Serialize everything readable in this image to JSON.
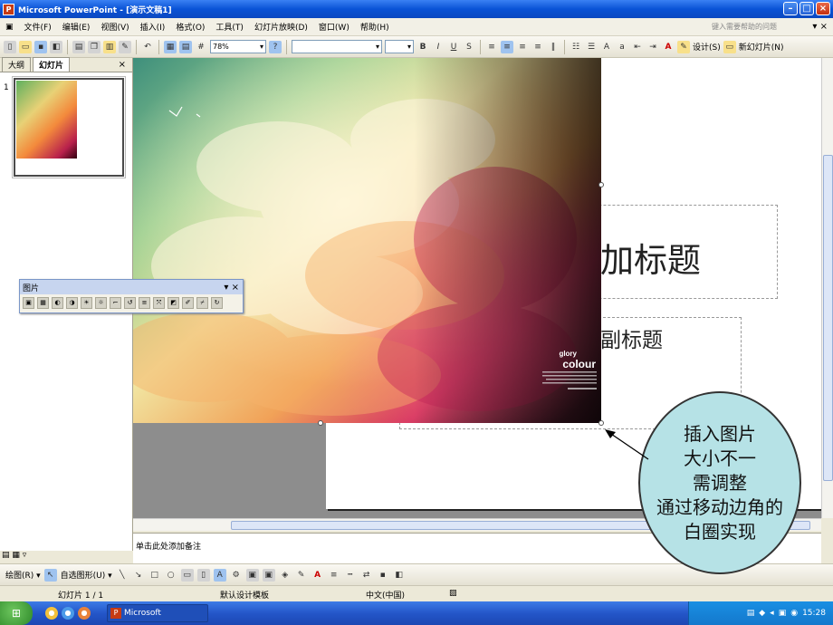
{
  "window": {
    "title": "Microsoft PowerPoint - [演示文稿1]",
    "app_icon": "P"
  },
  "menu": {
    "items": [
      "文件(F)",
      "编辑(E)",
      "视图(V)",
      "插入(I)",
      "格式(O)",
      "工具(T)",
      "幻灯片放映(D)",
      "窗口(W)",
      "帮助(H)"
    ],
    "help_placeholder": "键入需要帮助的问题",
    "close": "▾ ×"
  },
  "toolbar": {
    "zoom": "78%",
    "font_name": "",
    "font_size": "",
    "design_label": "设计(S)",
    "new_slide_label": "新幻灯片(N)"
  },
  "outline_pane": {
    "tab_outline": "大纲",
    "tab_slides": "幻灯片",
    "close": "×",
    "slide_number": "1"
  },
  "picture_toolbar": {
    "title": "图片",
    "close": "▾ ×"
  },
  "slide": {
    "title_placeholder": "加标题",
    "subtitle_placeholder": "副标题",
    "picture_text_top": "glory",
    "picture_text_main": "colour"
  },
  "notes": {
    "placeholder": "单击此处添加备注"
  },
  "drawing_toolbar": {
    "draw_label": "绘图(R) ▾",
    "autoshape_label": "自选图形(U) ▾"
  },
  "status": {
    "slide_info": "幻灯片 1 / 1",
    "template": "默认设计模板",
    "language": "中文(中国)"
  },
  "taskbar": {
    "task_label": "Microsoft PowerPoint -...",
    "clock": "15:28"
  },
  "callout": {
    "lines": [
      "插入图片",
      "大小不一",
      "需调整",
      "通过移动边角的",
      "白圈实现"
    ]
  },
  "colors": {
    "titlebar": "#0a53d6",
    "callout_fill": "#b6e2e6"
  }
}
